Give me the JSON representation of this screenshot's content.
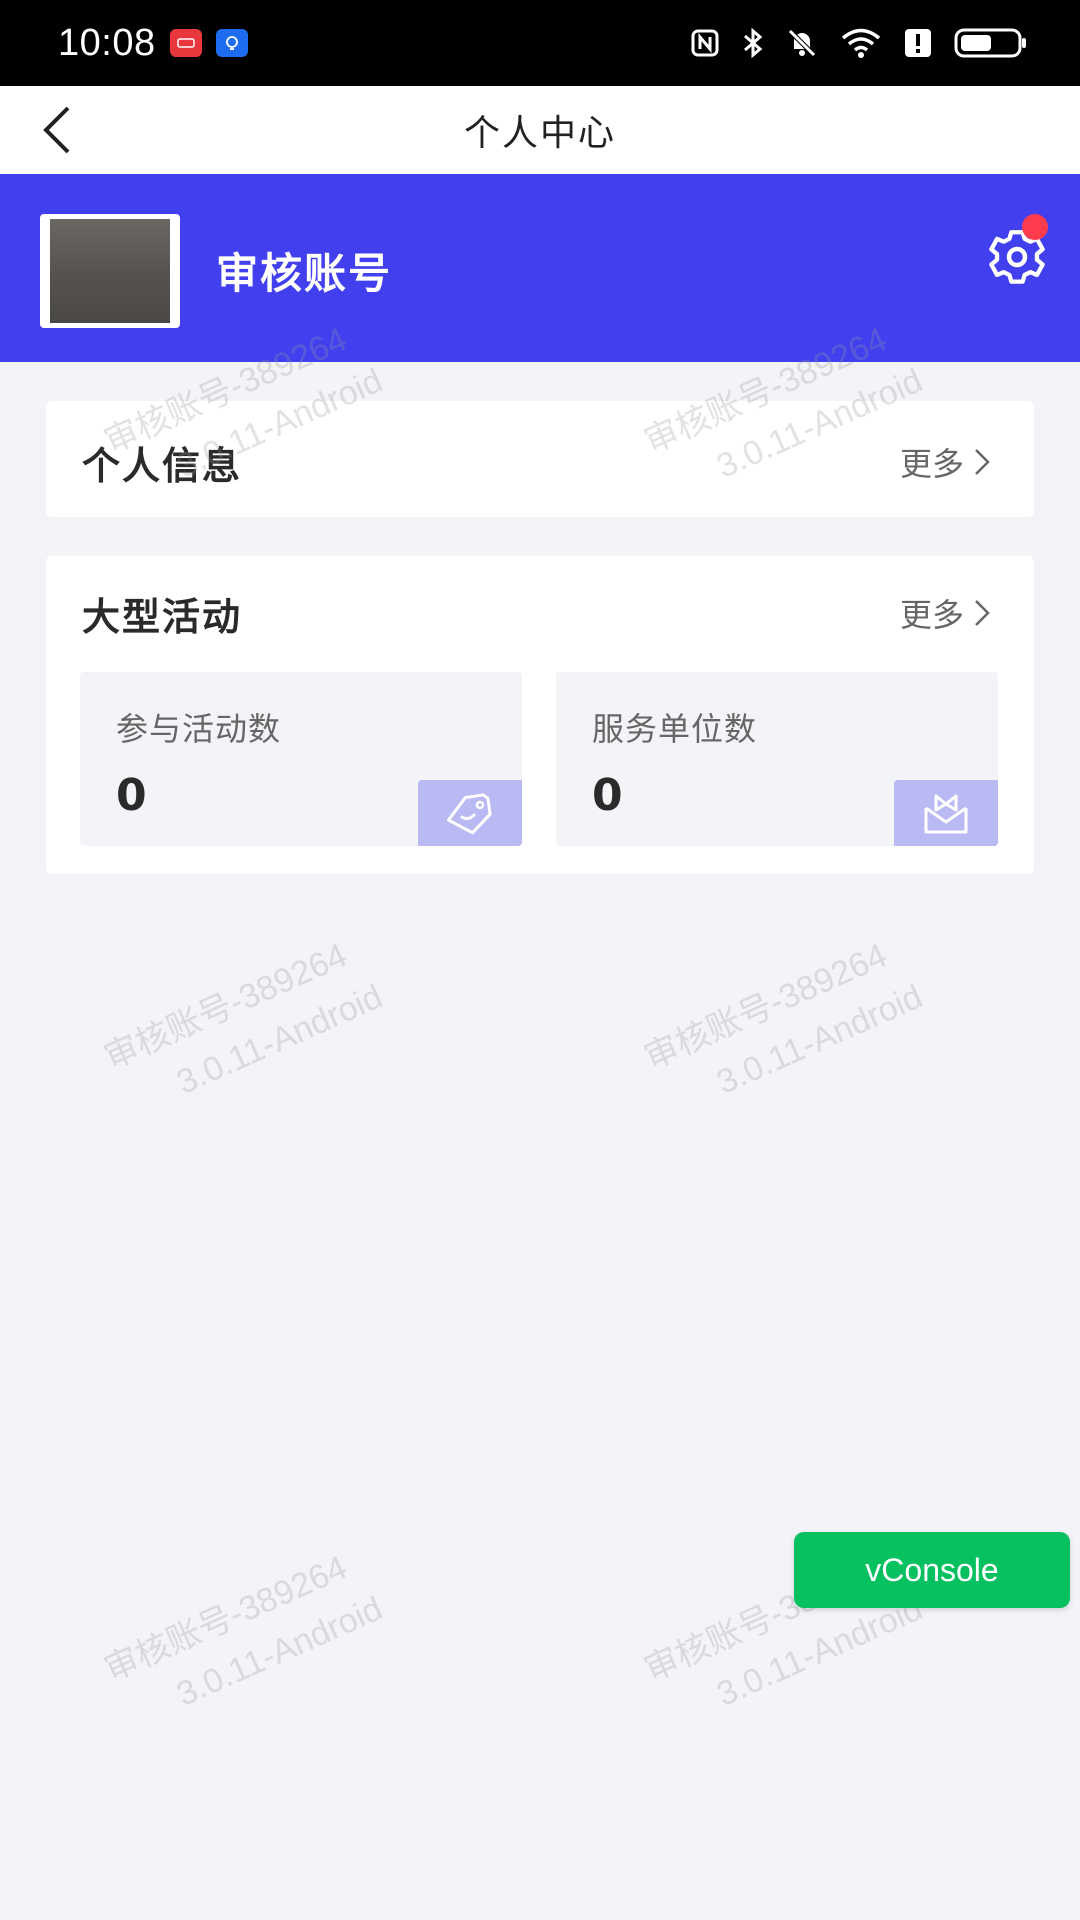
{
  "status_bar": {
    "time": "10:08",
    "icons": [
      "nfc-icon",
      "bluetooth-icon",
      "mute-icon",
      "wifi-icon",
      "alert-icon",
      "battery-icon"
    ]
  },
  "nav": {
    "title": "个人中心",
    "back_icon": "chevron-left-icon"
  },
  "profile": {
    "account_name": "审核账号",
    "settings_icon": "gear-icon",
    "settings_badge": true,
    "banner_color": "#4240ee"
  },
  "personal_info": {
    "title": "个人信息",
    "more_label": "更多"
  },
  "activities": {
    "title": "大型活动",
    "more_label": "更多",
    "stats": [
      {
        "label": "参与活动数",
        "value": "0",
        "icon": "tag-icon"
      },
      {
        "label": "服务单位数",
        "value": "0",
        "icon": "gift-icon"
      }
    ]
  },
  "watermark": {
    "line1": "审核账号-389264",
    "line2": "3.0.11-Android"
  },
  "vconsole": {
    "label": "vConsole",
    "color": "#07c160"
  }
}
